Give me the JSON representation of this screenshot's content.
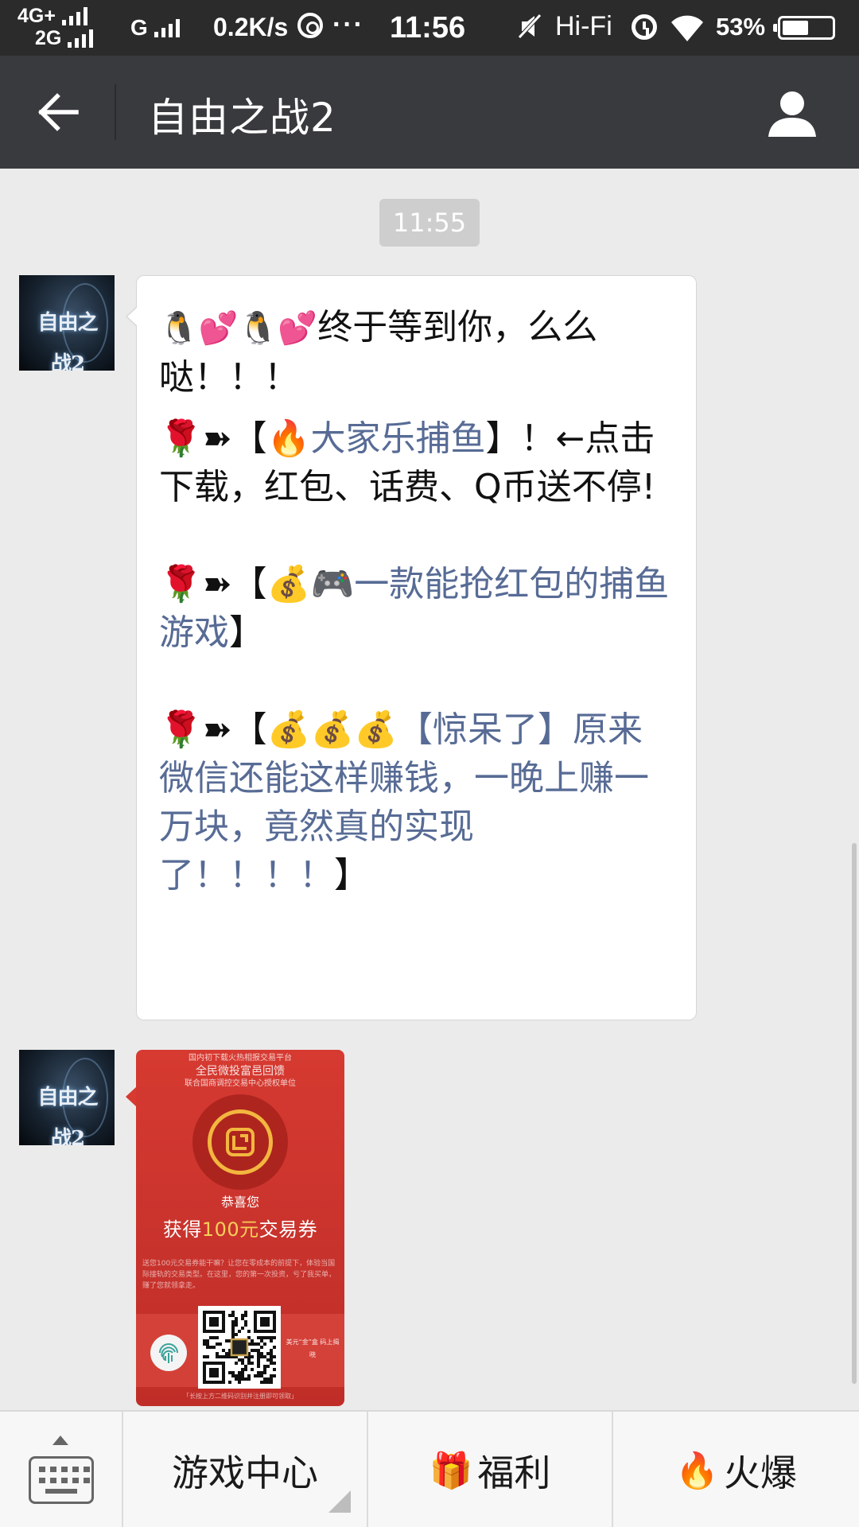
{
  "status_bar": {
    "net_top": "4G+",
    "net_bottom": "2G",
    "carrier2": "G",
    "speed": "0.2K/s",
    "more": "···",
    "time": "11:56",
    "audio": "Hi-Fi",
    "battery_pct": "53%",
    "battery_level": 0.53
  },
  "header": {
    "title": "自由之战2",
    "back_icon": "back-arrow-icon",
    "profile_icon": "person-icon"
  },
  "chat": {
    "timestamp": "11:55",
    "avatar_logo": "自由之战2",
    "message": {
      "line1_emoji": "🐧💕🐧💕",
      "line1_text": "终于等到你，么么哒！！！",
      "item1_prefix": "🌹➽【",
      "item1_link": "🔥大家乐捕鱼",
      "item1_suffix": "】！←点击下载，红包、话费、Q币送不停!",
      "item2_prefix": "🌹➽【",
      "item2_link": "💰🎮一款能抢红包的捕鱼游戏",
      "item2_suffix": "】",
      "item3_prefix": "🌹➽【",
      "item3_link": "💰💰💰【惊呆了】原来微信还能这样赚钱，一晚上赚一万块，竟然真的实现了！！！！",
      "item3_suffix": "】"
    },
    "card": {
      "top_line": "国内初下载火热相报交易平台",
      "brand": "全民微投富邑回馈",
      "sub_line": "联合国商调控交易中心授权单位",
      "congrats": "恭喜您",
      "headline_pre": "获得",
      "headline_amount": "100元",
      "headline_post": "交易券",
      "description": "送您100元交易券能干嘛？让您在零成本的前提下，体验当国际接轨的交易类型。在这里，您的第一次投资，亏了我买单，赚了您就领拿走。",
      "qr_side": "美元“金”盒 码上揭晓",
      "footer": "「长按上方二维码识别并注册即可领取」"
    }
  },
  "bottom_menu": {
    "keyboard_icon": "keyboard-icon",
    "items": [
      {
        "label": "游戏中心",
        "icon": ""
      },
      {
        "label": "福利",
        "icon": "🎁"
      },
      {
        "label": "火爆",
        "icon": "🔥"
      }
    ]
  },
  "colors": {
    "titlebar_bg": "#393a3e",
    "statusbar_bg": "#2b2b2b",
    "chat_bg": "#ebebeb",
    "link": "#576b95",
    "red_packet": "#d63a31",
    "gold": "#f6cf58"
  }
}
